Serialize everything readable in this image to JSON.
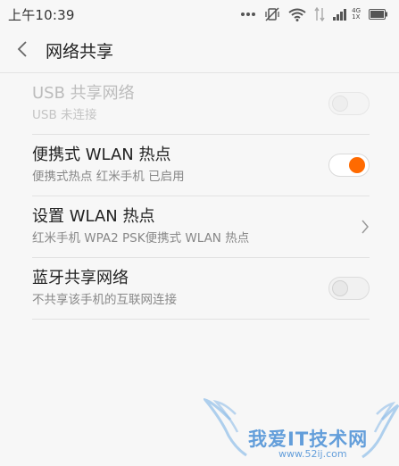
{
  "status_bar": {
    "time": "上午10:39",
    "network_type_top": "4G",
    "network_type_bottom": "1X"
  },
  "header": {
    "title": "网络共享"
  },
  "settings": [
    {
      "title": "USB 共享网络",
      "subtitle": "USB 未连接",
      "control": "toggle",
      "state": "off",
      "enabled": false
    },
    {
      "title": "便携式 WLAN 热点",
      "subtitle": "便携式热点 红米手机 已启用",
      "control": "toggle",
      "state": "on",
      "enabled": true
    },
    {
      "title": "设置 WLAN 热点",
      "subtitle": "红米手机 WPA2 PSK便携式 WLAN 热点",
      "control": "chevron",
      "enabled": true
    },
    {
      "title": "蓝牙共享网络",
      "subtitle": "不共享该手机的互联网连接",
      "control": "toggle",
      "state": "off",
      "enabled": true
    }
  ],
  "watermark": {
    "text": "我爱IT技术网",
    "url": "www.52ij.com"
  },
  "colors": {
    "accent": "#ff6a00",
    "background": "#f7f7f7",
    "watermark": "#4a8fd6"
  }
}
